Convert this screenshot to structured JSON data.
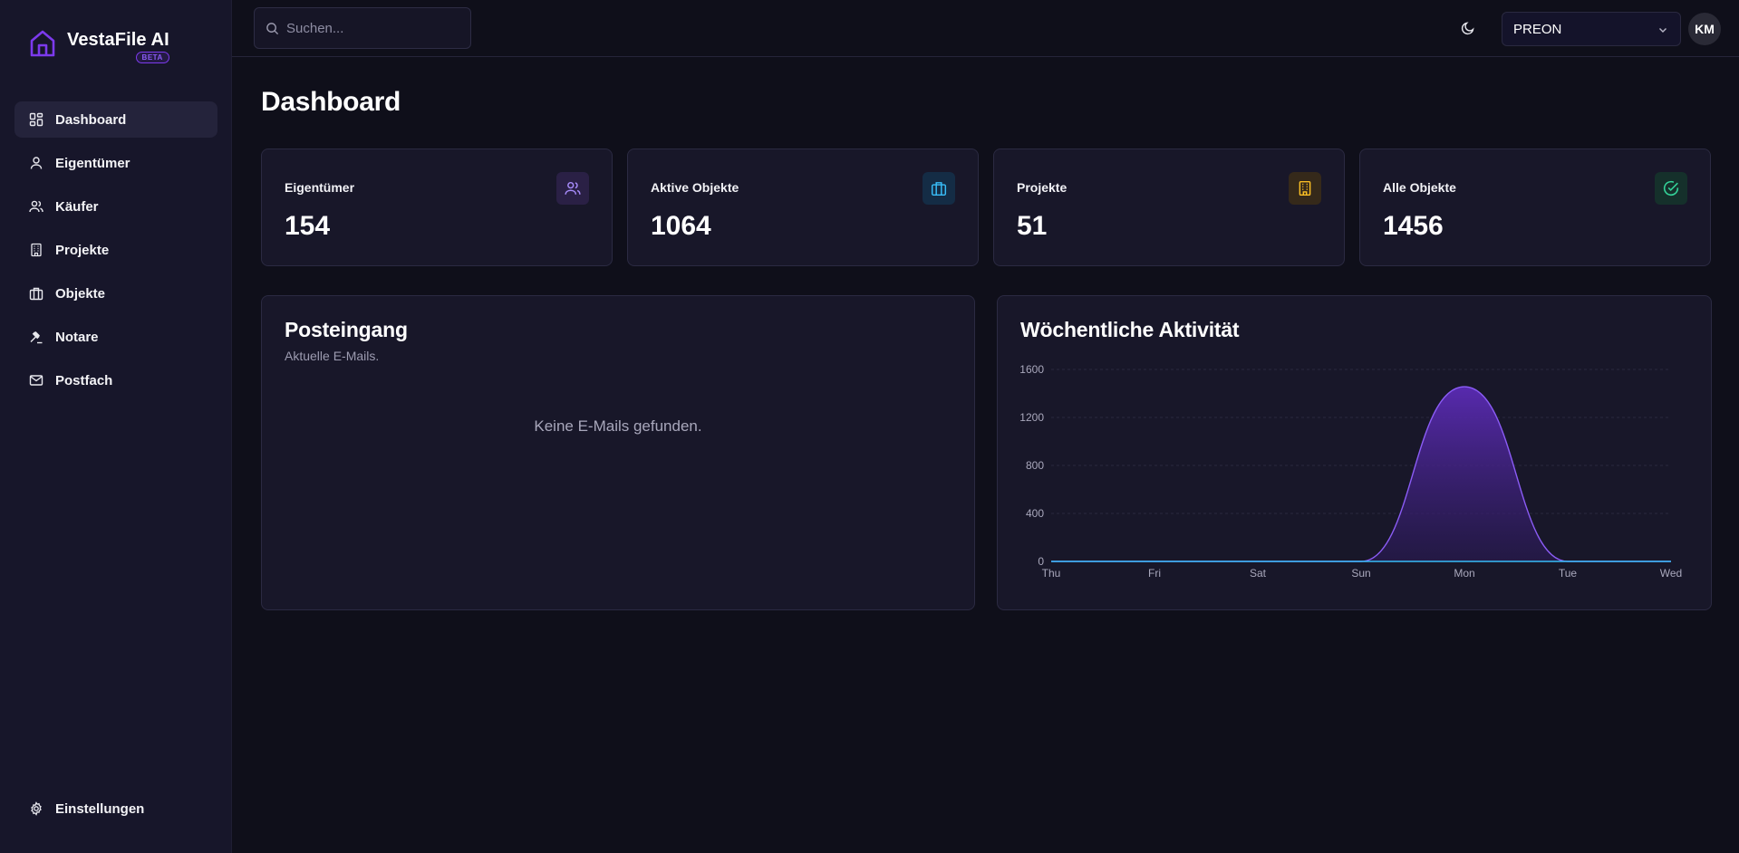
{
  "brand": {
    "name": "VestaFile AI",
    "badge": "BETA",
    "accent": "#7c3aed"
  },
  "sidebar": {
    "items": [
      {
        "label": "Dashboard",
        "icon": "dashboard-icon",
        "active": true
      },
      {
        "label": "Eigentümer",
        "icon": "user-icon"
      },
      {
        "label": "Käufer",
        "icon": "users-icon"
      },
      {
        "label": "Projekte",
        "icon": "building-icon"
      },
      {
        "label": "Objekte",
        "icon": "briefcase-icon"
      },
      {
        "label": "Notare",
        "icon": "gavel-icon"
      },
      {
        "label": "Postfach",
        "icon": "mail-icon"
      }
    ],
    "footer": {
      "label": "Einstellungen",
      "icon": "gear-icon"
    }
  },
  "header": {
    "search": {
      "placeholder": "Suchen...",
      "value": ""
    },
    "theme_icon": "moon-icon",
    "org_select": {
      "value": "PREON"
    },
    "avatar": "KM"
  },
  "main": {
    "title": "Dashboard",
    "stats": [
      {
        "label": "Eigentümer",
        "value": "154",
        "icon": "users-icon",
        "color": "#a78bfa",
        "bg": "#2a2045"
      },
      {
        "label": "Aktive Objekte",
        "value": "1064",
        "icon": "briefcase-icon",
        "color": "#38bdf8",
        "bg": "#142c45"
      },
      {
        "label": "Projekte",
        "value": "51",
        "icon": "building-icon",
        "color": "#fbbf24",
        "bg": "#35291a"
      },
      {
        "label": "Alle Objekte",
        "value": "1456",
        "icon": "check-circle-icon",
        "color": "#34d399",
        "bg": "#15302b"
      }
    ],
    "inbox": {
      "title": "Posteingang",
      "subtitle": "Aktuelle E-Mails.",
      "empty_message": "Keine E-Mails gefunden."
    },
    "activity": {
      "title": "Wöchentliche Aktivität"
    }
  },
  "chart_data": {
    "type": "area",
    "categories": [
      "Thu",
      "Fri",
      "Sat",
      "Sun",
      "Mon",
      "Tue",
      "Wed"
    ],
    "series": [
      {
        "values": [
          0,
          0,
          0,
          0,
          1456,
          0,
          0
        ],
        "color": "#7c3aed"
      },
      {
        "values": [
          0,
          0,
          0,
          0,
          0,
          0,
          0
        ],
        "color": "#38bdf8"
      }
    ],
    "yticks": [
      0,
      400,
      800,
      1200,
      1600
    ],
    "ylim": [
      0,
      1600
    ],
    "grid": true
  }
}
